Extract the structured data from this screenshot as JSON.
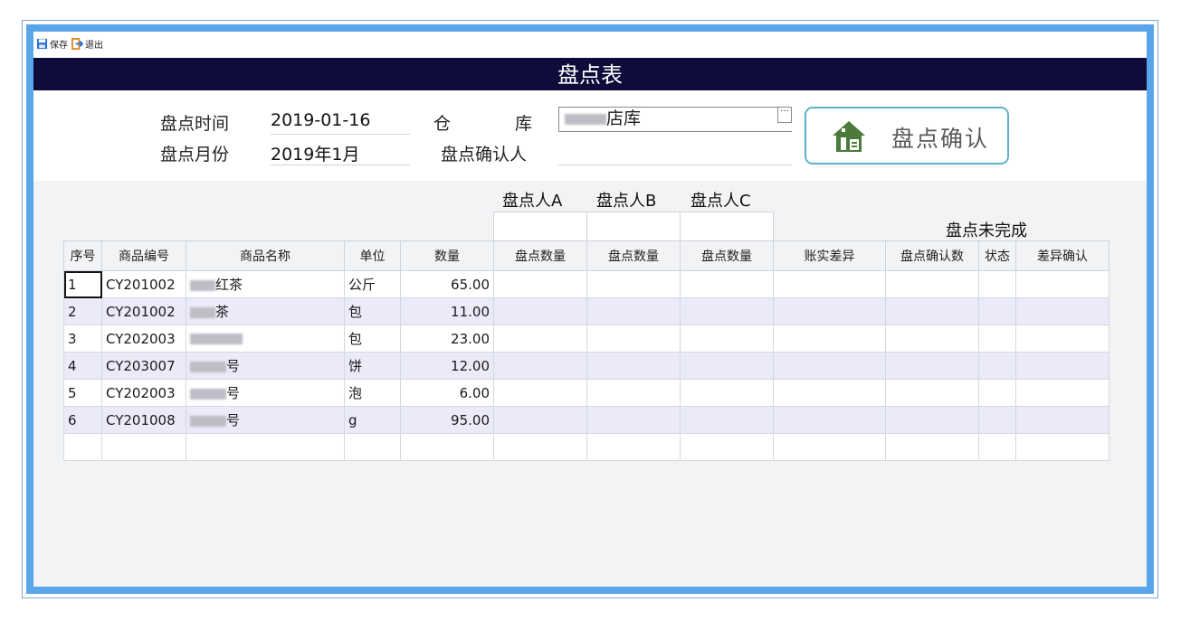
{
  "toolbar": {
    "save_label": "保存",
    "exit_label": "退出"
  },
  "title": "盘点表",
  "form": {
    "count_time_label": "盘点时间",
    "count_time_value": "2019-01-16",
    "count_month_label": "盘点月份",
    "count_month_value": "2019年1月",
    "warehouse_label_1": "仓",
    "warehouse_label_2": "库",
    "warehouse_value": "店库",
    "confirmer_label": "盘点确认人",
    "confirmer_value": "",
    "confirm_button": "盘点确认"
  },
  "groups": {
    "a": "盘点人A",
    "b": "盘点人B",
    "c": "盘点人C",
    "status": "盘点未完成"
  },
  "columns": [
    "序号",
    "商品编号",
    "商品名称",
    "单位",
    "数量",
    "盘点数量",
    "盘点数量",
    "盘点数量",
    "账实差异",
    "盘点确认数",
    "状态",
    "差异确认"
  ],
  "rows": [
    {
      "idx": "1",
      "code": "CY201002",
      "name": "红茶",
      "unit": "公斤",
      "qty": "65.00"
    },
    {
      "idx": "2",
      "code": "CY201002",
      "name": "茶",
      "unit": "包",
      "qty": "11.00"
    },
    {
      "idx": "3",
      "code": "CY202003",
      "name": "",
      "unit": "包",
      "qty": "23.00"
    },
    {
      "idx": "4",
      "code": "CY203007",
      "name": "号",
      "unit": "饼",
      "qty": "12.00"
    },
    {
      "idx": "5",
      "code": "CY202003",
      "name": "号",
      "unit": "泡",
      "qty": "6.00"
    },
    {
      "idx": "6",
      "code": "CY201008",
      "name": "号",
      "unit": "g",
      "qty": "95.00"
    }
  ],
  "colors": {
    "title_bg": "#0d0c3a",
    "frame_blue": "#5aa4ea",
    "alt_row": "#ebeaf8",
    "confirm_border": "#5fb0cc",
    "icon_green": "#4c7a3a"
  }
}
